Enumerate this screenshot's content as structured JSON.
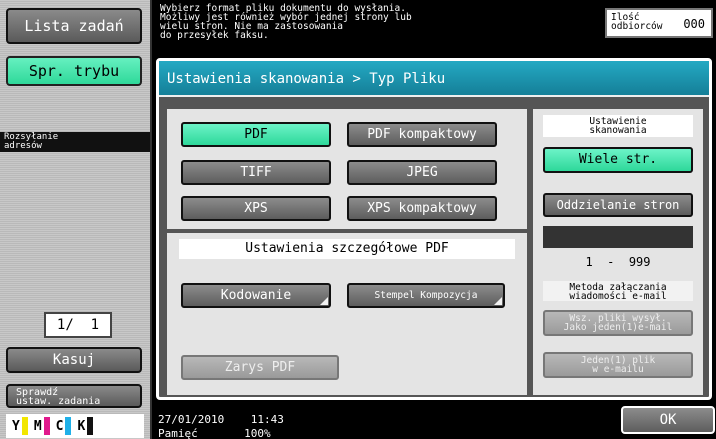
{
  "sidebar": {
    "job_list": "Lista zadań",
    "mode_change": "Spr. trybu",
    "address_panel": "Rozsyłanie\nadresów",
    "pager": "1/  1",
    "clear": "Kasuj",
    "check_settings": "Sprawdź\nustaw. zadania",
    "toner": [
      {
        "label": "Y",
        "color": "#f2e600"
      },
      {
        "label": "M",
        "color": "#e0198c"
      },
      {
        "label": "C",
        "color": "#1fb0e8"
      },
      {
        "label": "K",
        "color": "#111111"
      }
    ]
  },
  "header": {
    "message": "Wybierz format pliku dokumentu do wysłania.\nMożliwy jest również wybór jednej strony lub\nwielu stron. Nie ma zastosowania\ndo przesyłek faksu.",
    "recipients_label": "Ilość\nodbiorców",
    "recipients_count": "000"
  },
  "main": {
    "breadcrumb": "Ustawienia skanowania > Typ Pliku",
    "formats": [
      {
        "label": "PDF",
        "selected": true
      },
      {
        "label": "PDF kompaktowy",
        "selected": false
      },
      {
        "label": "TIFF",
        "selected": false
      },
      {
        "label": "JPEG",
        "selected": false
      },
      {
        "label": "XPS",
        "selected": false
      },
      {
        "label": "XPS kompaktowy",
        "selected": false
      }
    ],
    "pdf_details_title": "Ustawienia szczegółowe PDF",
    "encoding": "Kodowanie",
    "stamp": "Stempel Kompozycja",
    "pdf_outline": "Zarys PDF",
    "scan_setting_title": "Ustawienie\nskanowania",
    "multi_page": "Wiele str.",
    "separate_pages": "Oddzielanie stron",
    "page_range": "1  -  999",
    "attach_method_title": "Metoda załączania\nwiadomości e-mail",
    "all_files_one_mail": "Wsz. pliki wysył.\nJako jeden(1)e-mail",
    "one_file_per_mail": "Jeden(1) plik\nw e-mailu"
  },
  "footer": {
    "datetime": "27/01/2010    11:43",
    "memory": "Pamięć       100%",
    "ok": "OK"
  }
}
